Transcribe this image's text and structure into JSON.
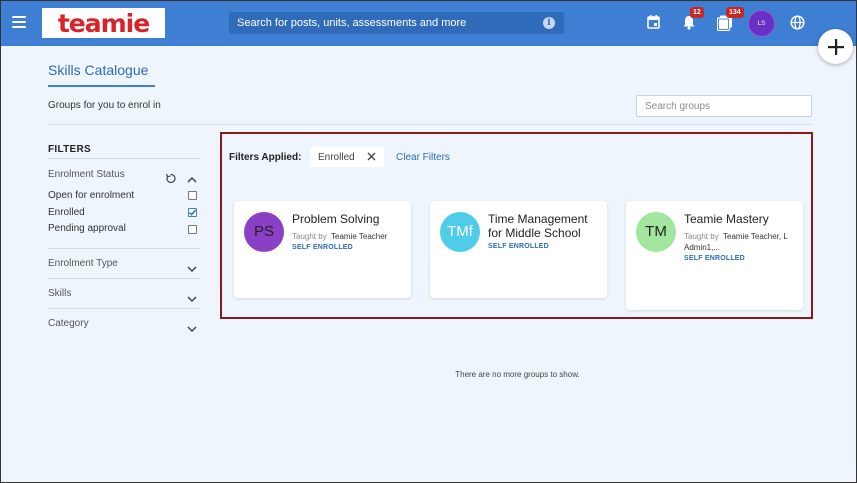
{
  "header": {
    "logo_text": "teamie",
    "search_placeholder": "Search for posts, units, assessments and more",
    "notifications_count": "12",
    "messages_count": "134",
    "avatar_initials": "LS"
  },
  "page": {
    "title": "Skills Catalogue",
    "subtitle": "Groups for you to enrol in",
    "search_groups_placeholder": "Search groups"
  },
  "filters": {
    "heading": "FILTERS",
    "enrolment_status": {
      "label": "Enrolment Status",
      "options": [
        {
          "label": "Open for enrolment",
          "checked": false
        },
        {
          "label": "Enrolled",
          "checked": true
        },
        {
          "label": "Pending approval",
          "checked": false
        }
      ]
    },
    "sections": [
      "Enrolment Type",
      "Skills",
      "Category"
    ]
  },
  "results": {
    "filters_applied_label": "Filters Applied:",
    "chip_label": "Enrolled",
    "clear_label": "Clear Filters",
    "taught_by_label": "Taught by",
    "cards": [
      {
        "initials": "PS",
        "avatar_color": "#8b3fc6",
        "text_color": "#222222",
        "name": "Problem Solving",
        "teacher": "Teamie Teacher",
        "status": "SELF ENROLLED"
      },
      {
        "initials": "TMf",
        "avatar_color": "#4fcde8",
        "text_color": "#ffffff",
        "name": "Time Management for Middle School",
        "teacher": "",
        "status": "SELF ENROLLED"
      },
      {
        "initials": "TM",
        "avatar_color": "#a3e6a0",
        "text_color": "#222222",
        "name": "Teamie Mastery",
        "teacher": "Teamie Teacher, L Admin1,...",
        "status": "SELF ENROLLED"
      }
    ],
    "no_more_text": "There are no more groups to show."
  },
  "colors": {
    "header_bg": "#3f7fd3",
    "highlight_border": "#8b1a1a",
    "accent": "#2f6bb8"
  }
}
